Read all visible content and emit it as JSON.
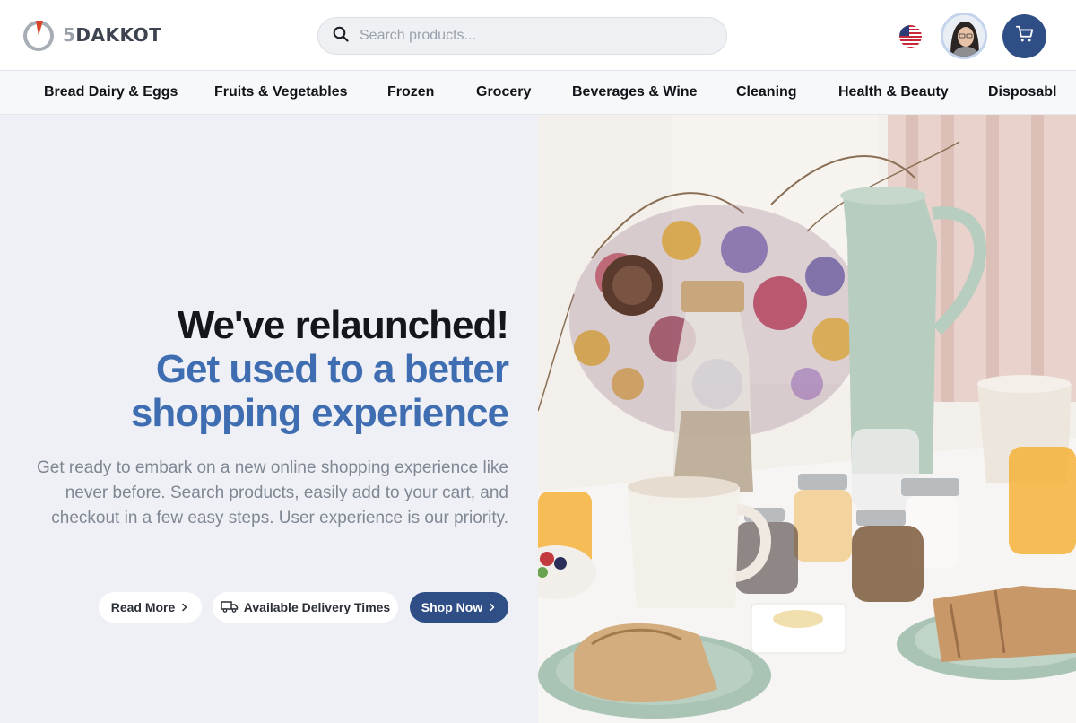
{
  "brand": {
    "number": "5",
    "name": "DAKKOT"
  },
  "search": {
    "placeholder": "Search products..."
  },
  "header": {
    "language_icon": "us-flag-icon",
    "cart_icon": "shopping-cart-icon",
    "avatar": "user-avatar"
  },
  "nav": {
    "items": [
      {
        "label": "Bread Dairy & Eggs"
      },
      {
        "label": "Fruits & Vegetables"
      },
      {
        "label": "Frozen"
      },
      {
        "label": "Grocery"
      },
      {
        "label": "Beverages & Wine"
      },
      {
        "label": "Cleaning"
      },
      {
        "label": "Health & Beauty"
      },
      {
        "label": "Disposabl"
      }
    ]
  },
  "hero": {
    "title_line1": "We've relaunched!",
    "title_line2": "Get used to a better",
    "title_line3": "shopping experience",
    "description": "Get ready to embark on a new online shopping experience like never before. Search products, easily add to your cart, and checkout in a few easy steps. User experience is our priority.",
    "buttons": {
      "read_more": "Read More",
      "delivery_times": "Available Delivery Times",
      "shop_now": "Shop Now"
    }
  },
  "colors": {
    "accent": "#2f4e86",
    "headline_blue": "#3f6db1",
    "logo_red": "#d9452b"
  }
}
